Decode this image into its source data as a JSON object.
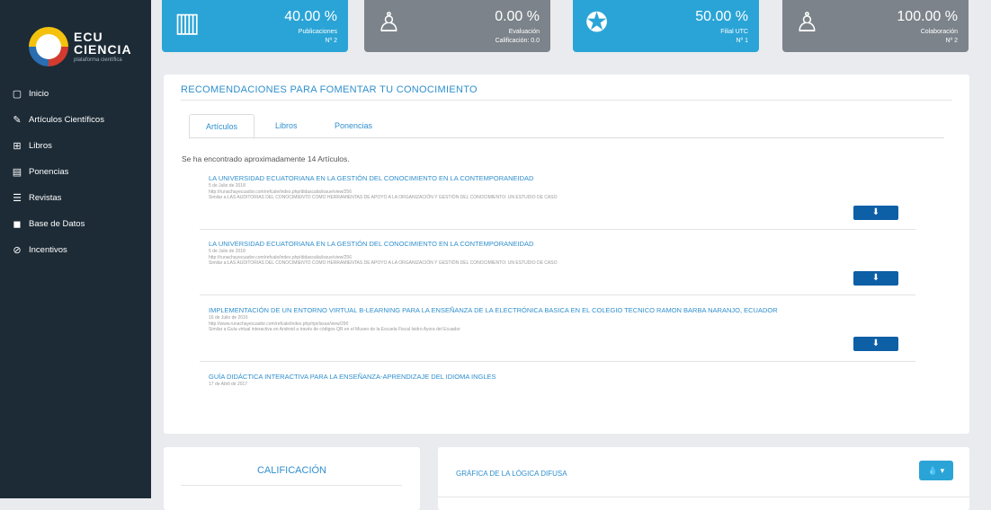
{
  "brand": {
    "name_line1": "ECU",
    "name_line2": "CIENCIA",
    "tagline": "plataforma científica"
  },
  "sidebar": {
    "items": [
      {
        "label": "Inicio",
        "icon": "square-icon"
      },
      {
        "label": "Artículos Científicos",
        "icon": "edit-icon"
      },
      {
        "label": "Libros",
        "icon": "book-icon"
      },
      {
        "label": "Ponencias",
        "icon": "newspaper-icon"
      },
      {
        "label": "Revistas",
        "icon": "list-icon"
      },
      {
        "label": "Base de Datos",
        "icon": "database-icon"
      },
      {
        "label": "Incentivos",
        "icon": "tag-icon"
      }
    ]
  },
  "stats": [
    {
      "percent": "40.00 %",
      "label": "Publicaciones",
      "sub": "Nº 2",
      "icon": "book-open-icon"
    },
    {
      "percent": "0.00 %",
      "label": "Evaluación",
      "sub": "Calificación: 0.0",
      "icon": "user-icon"
    },
    {
      "percent": "50.00 %",
      "label": "Filial UTC",
      "sub": "Nº 1",
      "icon": "star-circle-icon"
    },
    {
      "percent": "100.00 %",
      "label": "Colaboración",
      "sub": "Nº 2",
      "icon": "users-icon"
    }
  ],
  "recommendations": {
    "title": "RECOMENDACIONES PARA FOMENTAR TU CONOCIMIENTO",
    "tabs": [
      "Artículos",
      "Libros",
      "Ponencias"
    ],
    "found_text": "Se ha encontrado aproximadamente 14 Artículos.",
    "items": [
      {
        "title": "LA UNIVERSIDAD ECUATORIANA EN LA GESTIÓN DEL CONOCIMIENTO EN LA CONTEMPORANEIDAD",
        "date": "5 de Julio de 2018",
        "url": "http://runachayecuador.com/refcale/index.php/didascalia/issue/view/256",
        "similar": "Similar a:LAS AUDITORIAS DEL CONOCIMIENTO COMO HERRAMIENTAS DE APOYO A LA ORGANIZACIÓN Y GESTIÓN DEL CONOCIMIENTO: UN ESTUDIO DE CASO"
      },
      {
        "title": "LA UNIVERSIDAD ECUATORIANA EN LA GESTIÓN DEL CONOCIMIENTO EN LA CONTEMPORANEIDAD",
        "date": "5 de Julio de 2018",
        "url": "http://runachayecuador.com/refcale/index.php/didascalia/issue/view/256",
        "similar": "Similar a:LAS AUDITORIAS DEL CONOCIMIENTO COMO HERRAMIENTAS DE APOYO A LA ORGANIZACIÓN Y GESTIÓN DEL CONOCIMIENTO: UN ESTUDIO DE CASO"
      },
      {
        "title": "IMPLEMENTACIÓN DE UN ENTORNO VIRTUAL B-LEARNING PARA LA ENSEÑANZA DE LA ELECTRÓNICA BASICA EN EL COLEGIO TECNICO RAMON BARBA NARANJO, ECUADOR",
        "date": "16 de Julio de 2016",
        "url": "http://www.runachayecuador.com/refcale/index.php/ripi/issue/view/290",
        "similar": "Similar a:Guía virtual interactiva en Android a través de códigos QR en el Museo de la Escuela Fiscal Isidro Ayora del Ecuador"
      },
      {
        "title": "GUÍA DIDÁCTICA INTERACTIVA PARA LA ENSEÑANZA-APRENDIZAJE DEL IDIOMA INGLES",
        "date": "17 de Abril de 2017",
        "url": "",
        "similar": ""
      }
    ]
  },
  "bottom": {
    "left_title": "CALIFICACIÓN",
    "right_title": "GRÁFICA DE LA LÓGICA DIFUSA",
    "btn_label": "▾"
  }
}
